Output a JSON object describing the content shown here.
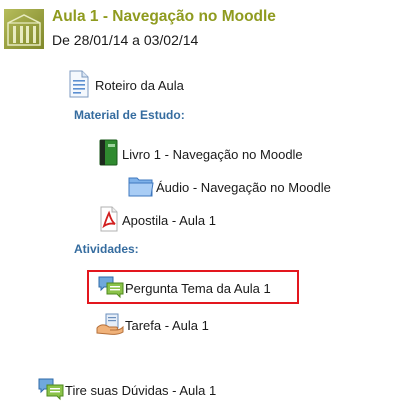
{
  "course": {
    "title": "Aula 1 - Navegação no Moodle",
    "dates": "De 28/01/14 a 03/02/14"
  },
  "items": [
    {
      "label": "Roteiro da Aula",
      "icon": "page-icon"
    },
    {
      "label": "Livro 1 - Navegação no Moodle",
      "icon": "book-icon"
    },
    {
      "label": "Áudio - Navegação no Moodle",
      "icon": "folder-icon"
    },
    {
      "label": "Apostila - Aula 1",
      "icon": "pdf-icon"
    },
    {
      "label": "Pergunta Tema da Aula 1",
      "icon": "forum-icon"
    },
    {
      "label": "Tarefa - Aula 1",
      "icon": "assignment-icon"
    },
    {
      "label": "Tire suas Dúvidas - Aula 1",
      "icon": "forum-icon"
    }
  ],
  "sections": {
    "study_material": "Material de Estudo:",
    "activities": "Atividades:"
  },
  "colors": {
    "title": "#8f9b1f",
    "section_label": "#356c9f",
    "highlight_border": "#e3171e"
  }
}
